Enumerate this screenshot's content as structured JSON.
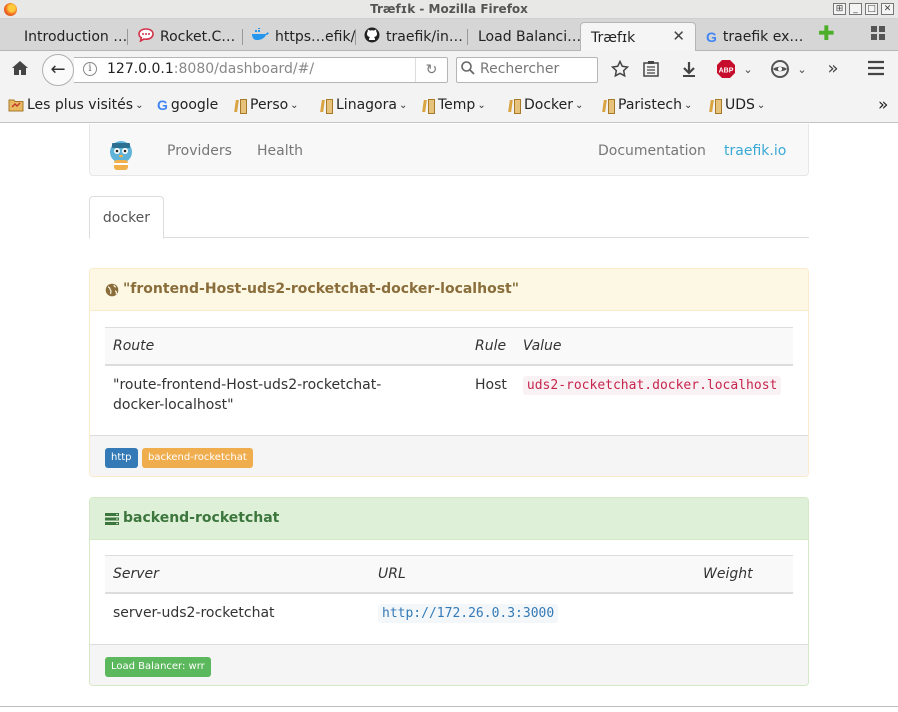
{
  "window": {
    "title": "Træfɪk - Mozilla Firefox"
  },
  "tabs": [
    {
      "label": "Introduction …",
      "icon": "none"
    },
    {
      "label": "Rocket.C…",
      "icon": "rocket-chat-icon"
    },
    {
      "label": "https…efik/",
      "icon": "docker-whale-icon"
    },
    {
      "label": "traefik/in…",
      "icon": "github-icon"
    },
    {
      "label": "Load Balanci…",
      "icon": "none"
    },
    {
      "label": "Træfɪk",
      "icon": "none",
      "active": true
    },
    {
      "label": "traefik ex…",
      "icon": "google-icon"
    }
  ],
  "nav": {
    "url_host": "127.0.0.1",
    "url_rest": ":8080/dashboard/#/",
    "search_placeholder": "Rechercher"
  },
  "bookmarks": [
    {
      "label": "Les plus visités",
      "type": "special"
    },
    {
      "label": "google",
      "type": "google"
    },
    {
      "label": "Perso",
      "type": "folder"
    },
    {
      "label": "Linagora",
      "type": "folder"
    },
    {
      "label": "Temp",
      "type": "folder"
    },
    {
      "label": "Docker",
      "type": "folder"
    },
    {
      "label": "Paristech",
      "type": "folder"
    },
    {
      "label": "UDS",
      "type": "folder"
    }
  ],
  "app": {
    "links": [
      "Providers",
      "Health"
    ],
    "right_links": [
      "Documentation",
      "traefik.io"
    ],
    "provider_tab": "docker"
  },
  "frontend": {
    "title": "\"frontend-Host-uds2-rocketchat-docker-localhost\"",
    "headers": [
      "Route",
      "Rule",
      "Value"
    ],
    "route": "\"route-frontend-Host-uds2-rocketchat-docker-localhost\"",
    "rule": "Host",
    "value": "uds2-rocketchat.docker.localhost",
    "badges": [
      "http",
      "backend-rocketchat"
    ]
  },
  "backend": {
    "title": "backend-rocketchat",
    "headers": [
      "Server",
      "URL",
      "Weight"
    ],
    "server": "server-uds2-rocketchat",
    "url": "http://172.26.0.3:3000",
    "weight": "",
    "lb_badge": "Load Balancer: wrr"
  },
  "colors": {
    "frontend_bg": "#fcf8e3",
    "frontend_border": "#faebcc",
    "frontend_text": "#8a6d3b",
    "backend_bg": "#dff0d8",
    "backend_border": "#d6e9c6",
    "backend_text": "#3c763d",
    "badge_blue": "#337ab7",
    "badge_orange": "#f0ad4e",
    "badge_green": "#5cb85c",
    "brand_link": "#3aa9d6"
  }
}
